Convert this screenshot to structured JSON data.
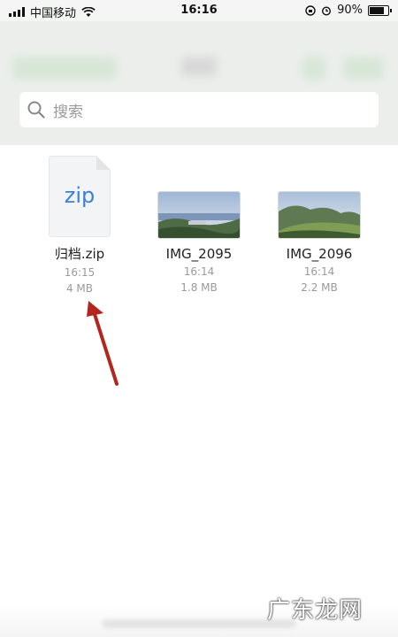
{
  "status_bar": {
    "carrier": "中国移动",
    "time": "16:16",
    "battery": "90%"
  },
  "search": {
    "placeholder": "搜索"
  },
  "files": [
    {
      "name": "归档.zip",
      "time": "16:15",
      "size": "4 MB",
      "type": "zip",
      "icon_label": "zip"
    },
    {
      "name": "IMG_2095",
      "time": "16:14",
      "size": "1.8 MB",
      "type": "image"
    },
    {
      "name": "IMG_2096",
      "time": "16:14",
      "size": "2.2 MB",
      "type": "image"
    }
  ],
  "colors": {
    "zip_label": "#3b82d6",
    "annotation_arrow": "#b3261e"
  },
  "watermark": "广东龙网"
}
